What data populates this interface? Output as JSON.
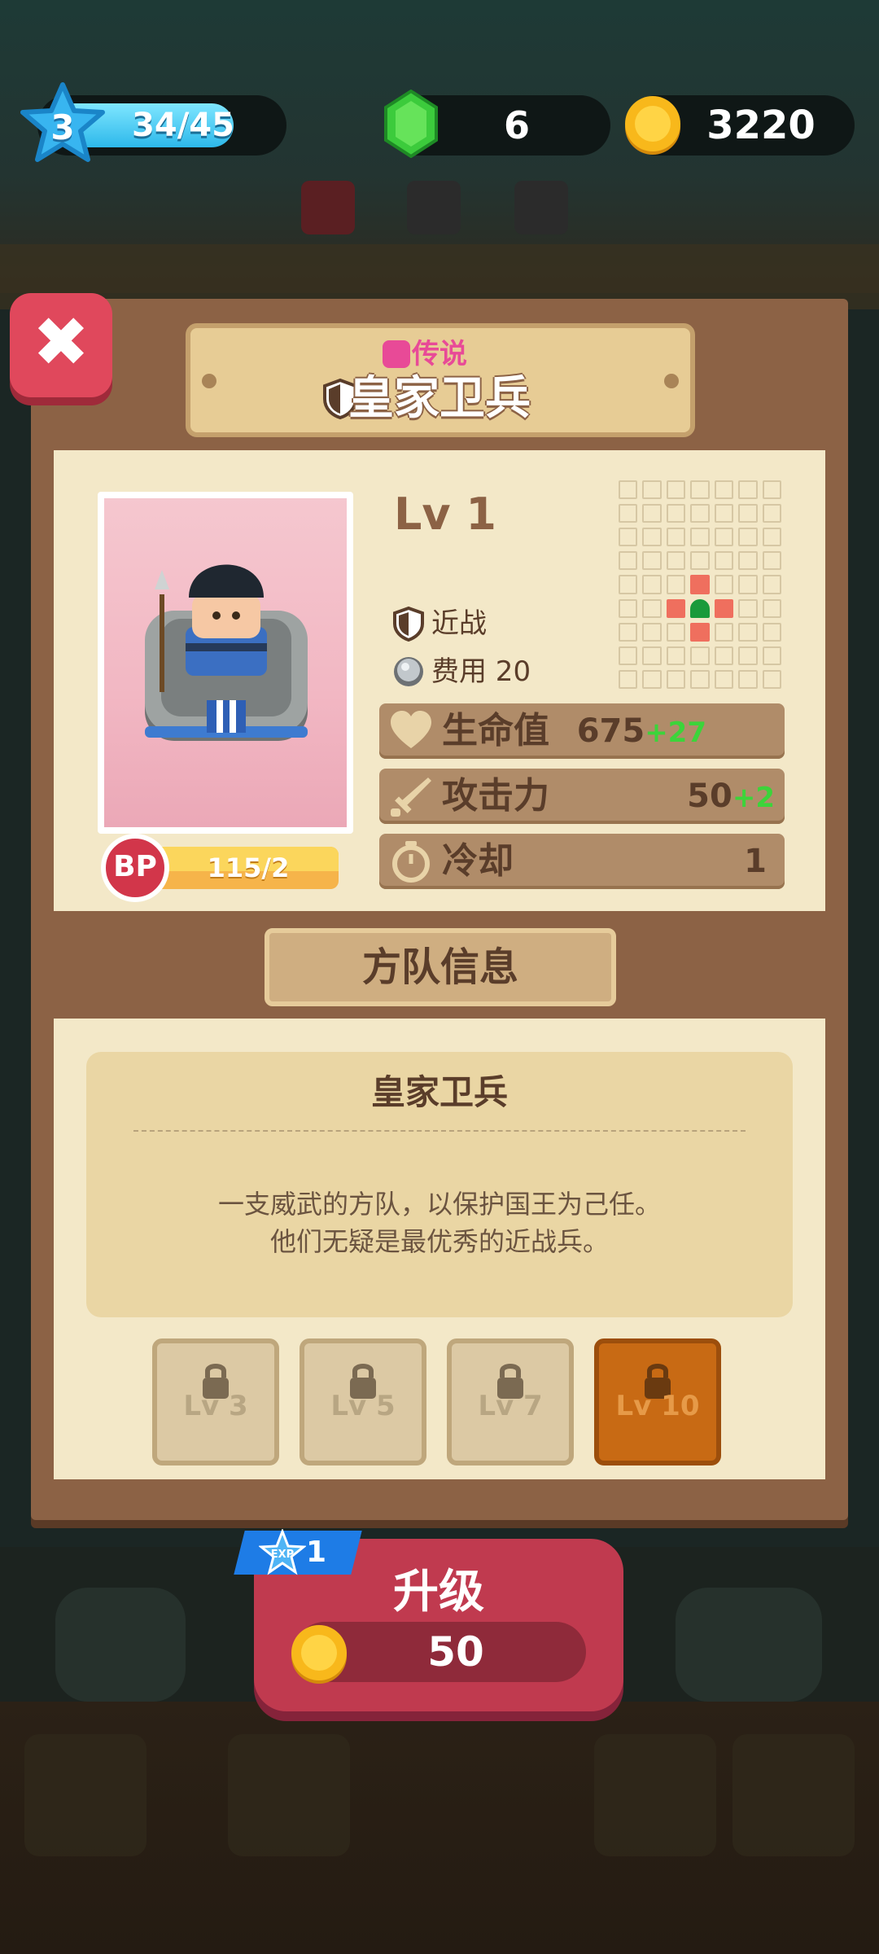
{
  "hud": {
    "player_level": "3",
    "xp": "34/45",
    "xp_fraction": 0.756,
    "gems": "6",
    "coins": "3220"
  },
  "card": {
    "rarity": "传说",
    "name": "皇家卫兵",
    "level": "Lv 1",
    "attack_type": "近战",
    "cost": "费用 20",
    "bp": "115/2",
    "bp_label": "BP",
    "stats": [
      {
        "label": "生命值",
        "value": "675",
        "bonus": "+27",
        "icon": "heart-icon"
      },
      {
        "label": "攻击力",
        "value": "50",
        "bonus": "+2",
        "icon": "sword-icon"
      },
      {
        "label": "冷却",
        "value": "1",
        "bonus": "",
        "icon": "stopwatch-icon"
      }
    ]
  },
  "squad": {
    "section_title": "方队信息",
    "title": "皇家卫兵",
    "desc_line1": "一支威武的方队，以保护国王为己任。",
    "desc_line2": "他们无疑是最优秀的近战兵。",
    "skills": [
      {
        "label": "Lv 3",
        "locked": true
      },
      {
        "label": "Lv 5",
        "locked": true
      },
      {
        "label": "Lv 7",
        "locked": true
      },
      {
        "label": "Lv 10",
        "locked": true,
        "highlighted": true
      }
    ]
  },
  "upgrade": {
    "exp_reward": "1",
    "exp_label": "EXP",
    "label": "升级",
    "cost": "50"
  },
  "colors": {
    "panel": "#8c6245",
    "card": "#f3e8c8",
    "rarity": "#e84a97",
    "bonus": "#3cd43a",
    "upgrade": "#c03a4f"
  }
}
